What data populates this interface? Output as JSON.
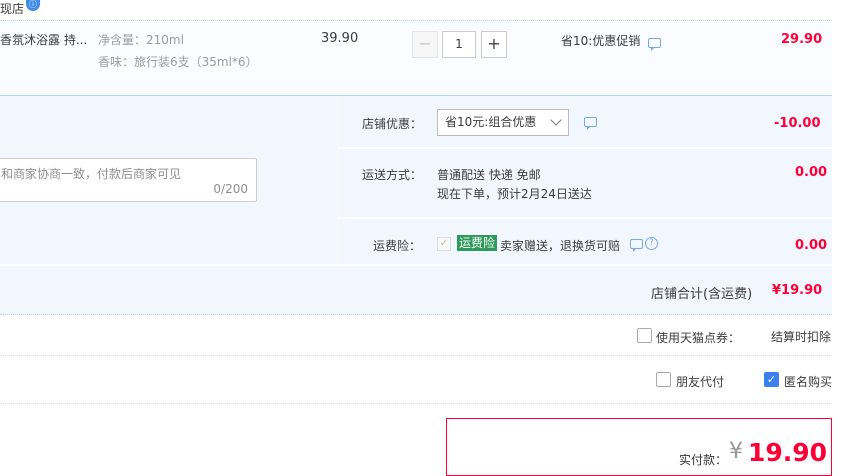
{
  "shop": {
    "name_partial": "现店",
    "badge_icon": "info-badge-icon"
  },
  "item": {
    "title": "香氛沐浴露 持...",
    "spec_volume": "净含量：210ml",
    "spec_scent": "香味：旅行装6支（35ml*6）",
    "unit_price": "39.90",
    "quantity": "1",
    "minus": "−",
    "plus": "+",
    "promo": "省10:优惠促销",
    "subtotal": "29.90"
  },
  "memo": {
    "placeholder": "和商家协商一致，付款后商家可见",
    "count": "0/200"
  },
  "store_discount": {
    "label": "店铺优惠：",
    "selected": "省10元:组合优惠",
    "amount": "-10.00"
  },
  "shipping": {
    "label": "运送方式：",
    "method": "普通配送 快递 免邮",
    "eta": "现在下单，预计2月24日送达",
    "amount": "0.00"
  },
  "insurance": {
    "label": "运费险：",
    "tag": "运费险",
    "desc": "卖家赠送，退换货可赔",
    "amount": "0.00",
    "help": "?"
  },
  "store_total": {
    "label": "店铺合计(含运费)",
    "amount": "¥19.90"
  },
  "tmall_points": {
    "label": "使用天猫点券：",
    "note": "结算时扣除",
    "checked": false
  },
  "friend_pay": {
    "label": "朋友代付",
    "checked": false
  },
  "anonymous": {
    "label": "匿名购买",
    "checked": true,
    "check_mark": "✓"
  },
  "payment": {
    "label": "实付款：",
    "symbol": "¥",
    "amount": "19.90"
  },
  "colors": {
    "accent_red": "#ff0036",
    "link_blue": "#3b80f0",
    "panel_bg": "#f2f7ff",
    "insurance_green": "#2e9a5a"
  }
}
